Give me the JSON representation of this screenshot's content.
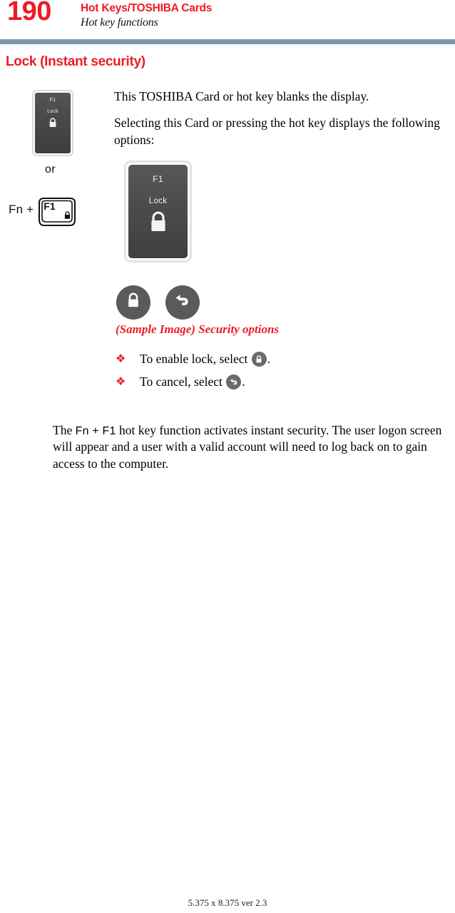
{
  "header": {
    "page_number": "190",
    "chapter_title": "Hot Keys/TOSHIBA Cards",
    "section_title": "Hot key functions",
    "rule_color": "#7f95ac",
    "accent_color": "#ed1c24"
  },
  "section": {
    "heading": "Lock (Instant security)"
  },
  "graphics": {
    "card_thumbnail": {
      "key_label": "F1",
      "function_label": "Lock",
      "icon": "padlock-icon"
    },
    "or_label": "or",
    "hotkey": {
      "modifier_label": "Fn +",
      "keycap_label": "F1",
      "keycap_icon": "padlock-icon"
    },
    "card_large": {
      "key_label": "F1",
      "function_label": "Lock",
      "icon": "padlock-icon"
    }
  },
  "body": {
    "paragraph_1": "This TOSHIBA Card or hot key blanks the display.",
    "paragraph_2": "Selecting this Card or pressing the hot key displays the following options:"
  },
  "options": {
    "buttons": [
      {
        "name": "lock-option-button",
        "icon": "padlock-icon"
      },
      {
        "name": "cancel-option-button",
        "icon": "undo-arrow-icon"
      }
    ],
    "caption": "(Sample Image) Security options"
  },
  "bullets": [
    {
      "marker": "❖",
      "text_before": "To enable lock, select",
      "icon": "padlock-icon",
      "text_after": "."
    },
    {
      "marker": "❖",
      "text_before": "To cancel, select",
      "icon": "undo-arrow-icon",
      "text_after": "."
    }
  ],
  "closing": {
    "lead": "The",
    "key_combo": "Fn + F1",
    "rest": "hot key function activates instant security. The user logon screen will appear and a user with a valid account will need to log back on to gain access to the computer."
  },
  "footer": {
    "text": "5.375 x 8.375 ver 2.3"
  }
}
